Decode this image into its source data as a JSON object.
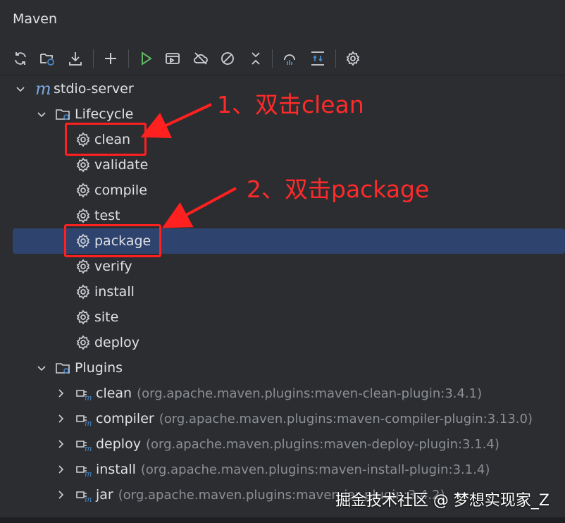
{
  "window": {
    "title": "Maven"
  },
  "toolbar": {
    "icons": [
      "reload-icon",
      "reimport-folder-icon",
      "download-icon",
      "add-icon",
      "run-icon",
      "run-configuration-icon",
      "offline-icon",
      "skip-tests-icon",
      "collapse-icon",
      "analyze-dependencies-icon",
      "expand-toggle-icon",
      "settings-icon"
    ]
  },
  "tree": {
    "project": {
      "label": "stdio-server",
      "icon": "maven-m-icon"
    },
    "lifecycle": {
      "label": "Lifecycle",
      "items": [
        "clean",
        "validate",
        "compile",
        "test",
        "package",
        "verify",
        "install",
        "site",
        "deploy"
      ],
      "selected": "package"
    },
    "plugins": {
      "label": "Plugins",
      "items": [
        {
          "name": "clean",
          "desc": "(org.apache.maven.plugins:maven-clean-plugin:3.4.1)"
        },
        {
          "name": "compiler",
          "desc": "(org.apache.maven.plugins:maven-compiler-plugin:3.13.0)"
        },
        {
          "name": "deploy",
          "desc": "(org.apache.maven.plugins:maven-deploy-plugin:3.1.4)"
        },
        {
          "name": "install",
          "desc": "(org.apache.maven.plugins:maven-install-plugin:3.1.4)"
        },
        {
          "name": "jar",
          "desc": "(org.apache.maven.plugins:maven-jar-plugin:3.4.2)"
        }
      ]
    }
  },
  "annotations": {
    "step1": "1、双击clean",
    "step2": "2、双击package",
    "color": "#ff2020"
  },
  "watermark": "掘金技术社区 @ 梦想实现家_Z",
  "colors": {
    "background": "#2b2d30",
    "selection": "#2e436e",
    "run_green": "#5fb865",
    "accent_blue": "#4a88c7"
  }
}
